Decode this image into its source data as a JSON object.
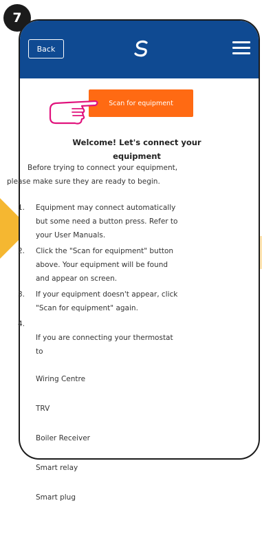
{
  "step_badge": "7",
  "header": {
    "back_label": "Back",
    "logo_icon": "salus-logo-icon",
    "menu_icon": "hamburger-menu-icon",
    "bg_color": "#0f4a92"
  },
  "scan_button": {
    "label": "Scan for equipment",
    "color": "#ff6a13"
  },
  "welcome": {
    "line1": "Welcome! Let's connect your",
    "line2": "equipment"
  },
  "intro": {
    "line1": "Before trying to connect your equipment,",
    "line2": "please make sure they are ready to begin."
  },
  "steps": [
    {
      "num": "1.",
      "text": "Equipment may connect automatically\nbut some need a button press. Refer to\nyour User Manuals."
    },
    {
      "num": "2.",
      "text": "Click the \"Scan for equipment\" button\nabove. Your equipment will be found\nand appear on screen."
    },
    {
      "num": "3.",
      "text": "If your equipment doesn't appear, click\n\"Scan for equipment\" again."
    },
    {
      "num": "4.",
      "text": "If you are connecting your thermostat\nto"
    }
  ],
  "devices": [
    "Wiring Centre",
    "TRV",
    "Boiler Receiver",
    "Smart relay",
    "Smart plug"
  ]
}
